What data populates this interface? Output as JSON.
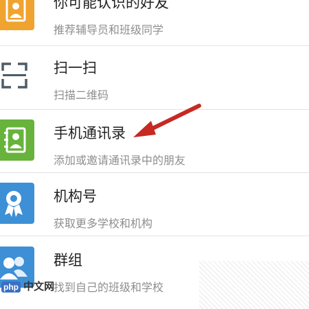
{
  "list": [
    {
      "title": "你可能认识的好友",
      "subtitle": "推荐辅导员和班级同学",
      "icon": "contacts-book-icon",
      "icon_color": "#f0a32e"
    },
    {
      "title": "扫一扫",
      "subtitle": "扫描二维码",
      "icon": "scan-frame-icon",
      "icon_color": "#4d5b66"
    },
    {
      "title": "手机通讯录",
      "subtitle": "添加或邀请通讯录中的朋友",
      "icon": "phone-contacts-icon",
      "icon_color": "#67b33c"
    },
    {
      "title": "机构号",
      "subtitle": "获取更多学校和机构",
      "icon": "institution-badge-icon",
      "icon_color": "#3d8fd6"
    },
    {
      "title": "群组",
      "subtitle": "找到自己的班级和学校",
      "icon": "group-icon",
      "icon_color": "#3d8fd6"
    }
  ],
  "annotation": {
    "arrow_color": "#c62a23"
  },
  "watermark": {
    "badge": "php",
    "text": "中文网"
  }
}
